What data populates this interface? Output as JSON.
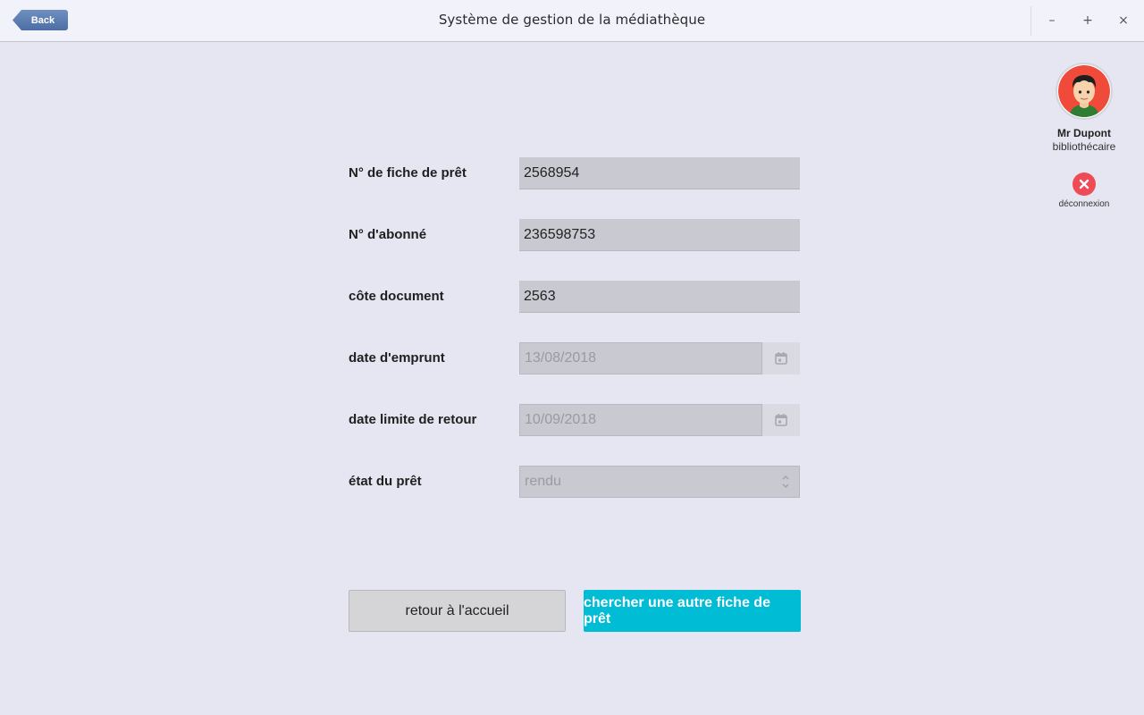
{
  "titlebar": {
    "back_label": "Back",
    "title": "Système de gestion de la médiathèque",
    "minimize_glyph": "–",
    "maximize_glyph": "+",
    "close_glyph": "×"
  },
  "user": {
    "name": "Mr Dupont",
    "role": "bibliothécaire",
    "logout_label": "déconnexion"
  },
  "form": {
    "loan_number": {
      "label": "N° de fiche de prêt",
      "value": "2568954"
    },
    "subscriber_number": {
      "label": "N° d'abonné",
      "value": "236598753"
    },
    "document_code": {
      "label": "côte document",
      "value": "2563"
    },
    "loan_date": {
      "label": "date d'emprunt",
      "value": "13/08/2018"
    },
    "return_date": {
      "label": "date limite de retour",
      "value": "10/09/2018"
    },
    "loan_status": {
      "label": "état du prêt",
      "value": "rendu"
    }
  },
  "buttons": {
    "home": "retour à l'accueil",
    "search_other": "chercher une autre fiche de prêt"
  },
  "colors": {
    "background": "#e6e6f2",
    "primary_button": "#00bcd4",
    "logout_icon": "#ee4b57",
    "back_button": "#4c6ea4"
  }
}
